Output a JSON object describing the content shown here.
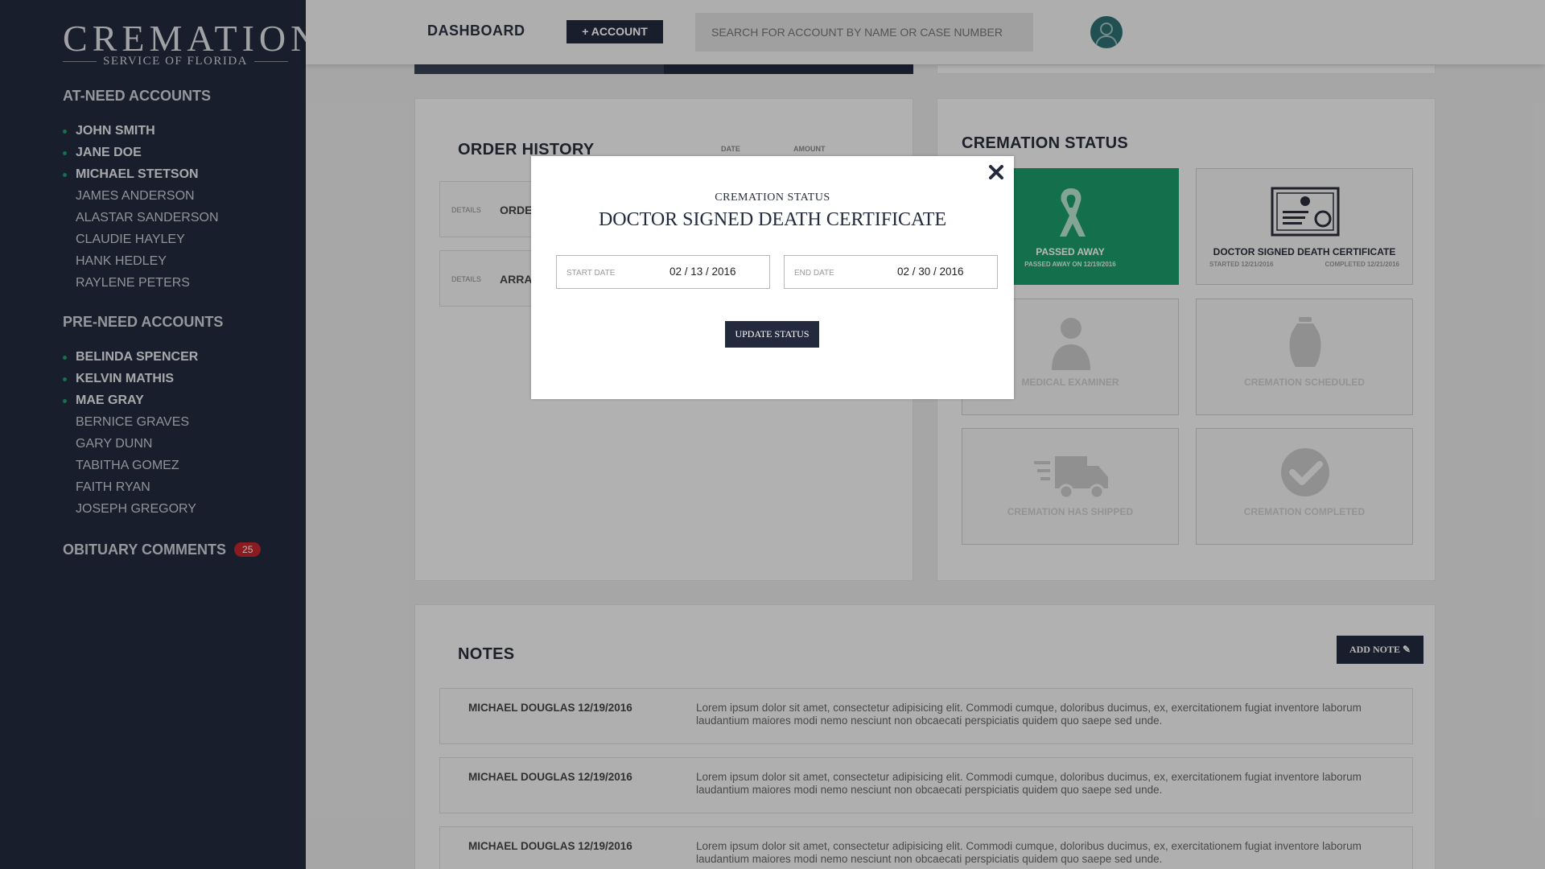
{
  "logo": {
    "main": "CREMATION",
    "sub": "SERVICE OF FLORIDA"
  },
  "sidebar": {
    "at_need_title": "AT-NEED ACCOUNTS",
    "at_need": [
      {
        "name": "JOHN SMITH",
        "active": true
      },
      {
        "name": "JANE DOE",
        "active": true
      },
      {
        "name": "MICHAEL STETSON",
        "active": true
      },
      {
        "name": "JAMES ANDERSON",
        "active": false
      },
      {
        "name": "ALASTAR SANDERSON",
        "active": false
      },
      {
        "name": "CLAUDIE HAYLEY",
        "active": false
      },
      {
        "name": "HANK HEDLEY",
        "active": false
      },
      {
        "name": "RAYLENE PETERS",
        "active": false
      }
    ],
    "pre_need_title": "PRE-NEED ACCOUNTS",
    "pre_need": [
      {
        "name": "BELINDA SPENCER",
        "active": true
      },
      {
        "name": "KELVIN MATHIS",
        "active": true
      },
      {
        "name": "MAE GRAY",
        "active": true
      },
      {
        "name": "BERNICE GRAVES",
        "active": false
      },
      {
        "name": "GARY DUNN",
        "active": false
      },
      {
        "name": "TABITHA GOMEZ",
        "active": false
      },
      {
        "name": "FAITH RYAN",
        "active": false
      },
      {
        "name": "JOSEPH GREGORY",
        "active": false
      }
    ],
    "obituary_label": "OBITUARY COMMENTS",
    "obituary_count": "25"
  },
  "topbar": {
    "dashboard": "DASHBOARD",
    "add_account": "+ ACCOUNT",
    "search_placeholder": "SEARCH FOR ACCOUNT BY NAME OR CASE NUMBER"
  },
  "order_history": {
    "title": "ORDER HISTORY",
    "col_date": "DATE",
    "col_amount": "AMOUNT",
    "rows": [
      {
        "label": "DETAILS",
        "text": "ORDE"
      },
      {
        "label": "DETAILS",
        "text": "ARRA"
      }
    ]
  },
  "cremation_status": {
    "title": "CREMATION STATUS",
    "tiles": [
      {
        "label": "PASSED AWAY",
        "sub": "PASSED AWAY ON 12/19/2016",
        "state": "complete",
        "icon": "ribbon-icon"
      },
      {
        "label": "DOCTOR SIGNED DEATH CERTIFICATE",
        "started": "STARTED 12/21/2016",
        "completed": "COMPLETED 12/21/2016",
        "state": "current",
        "icon": "certificate-icon"
      },
      {
        "label": "MEDICAL EXAMINER",
        "state": "pending",
        "icon": "doctor-icon"
      },
      {
        "label": "CREMATION SCHEDULED",
        "state": "pending",
        "icon": "urn-icon"
      },
      {
        "label": "CREMATION HAS SHIPPED",
        "state": "pending",
        "icon": "truck-icon"
      },
      {
        "label": "CREMATION COMPLETED",
        "state": "pending",
        "icon": "check-circle-icon"
      }
    ]
  },
  "notes": {
    "title": "NOTES",
    "add_label": "ADD NOTE",
    "rows": [
      {
        "author": "MICHAEL DOUGLAS 12/19/2016",
        "text": "Lorem ipsum dolor sit amet, consectetur adipisicing elit. Commodi cumque, doloribus ducimus, ex, exercitationem fugiat inventore laborum laudantium maiores modi nemo nesciunt non obcaecati perspiciatis quidem quo saepe sed unde."
      },
      {
        "author": "MICHAEL DOUGLAS 12/19/2016",
        "text": "Lorem ipsum dolor sit amet, consectetur adipisicing elit. Commodi cumque, doloribus ducimus, ex, exercitationem fugiat inventore laborum laudantium maiores modi nemo nesciunt non obcaecati perspiciatis quidem quo saepe sed unde."
      },
      {
        "author": "MICHAEL DOUGLAS 12/19/2016",
        "text": "Lorem ipsum dolor sit amet, consectetur adipisicing elit. Commodi cumque, doloribus ducimus, ex, exercitationem fugiat inventore laborum laudantium maiores modi nemo nesciunt non obcaecati perspiciatis quidem quo saepe sed unde."
      }
    ]
  },
  "modal": {
    "subtitle": "CREMATION STATUS",
    "title": "DOCTOR SIGNED DEATH CERTIFICATE",
    "start_label": "START DATE",
    "start_value": "02 / 13 / 2016",
    "end_label": "END DATE",
    "end_value": "02 / 30 / 2016",
    "update_label": "UPDATE STATUS"
  },
  "colors": {
    "sidebar": "#232a3d",
    "accent_green": "#1d9b6a",
    "badge_red": "#c0262f"
  }
}
